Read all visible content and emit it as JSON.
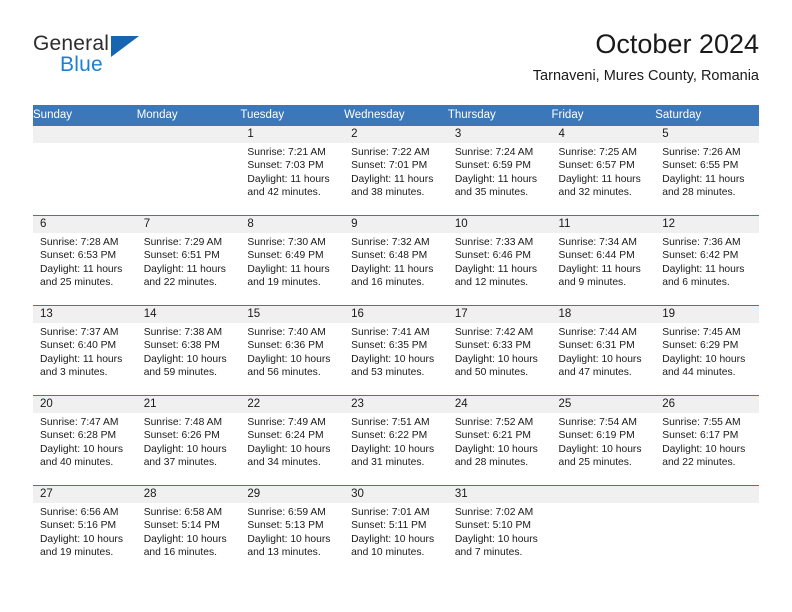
{
  "logo": {
    "word1": "General",
    "word2": "Blue",
    "triangle_color": "#1565b0",
    "blue_text_color": "#1c7fd4"
  },
  "header": {
    "title": "October 2024",
    "subtitle": "Tarnaveni, Mures County, Romania"
  },
  "theme": {
    "header_blue": "#3b77b9",
    "daynum_band": "#f0f0f0",
    "text": "#1a1a1a"
  },
  "weekday_headers": [
    "Sunday",
    "Monday",
    "Tuesday",
    "Wednesday",
    "Thursday",
    "Friday",
    "Saturday"
  ],
  "weeks": [
    [
      {
        "day": "",
        "lines": []
      },
      {
        "day": "",
        "lines": []
      },
      {
        "day": "1",
        "lines": [
          "Sunrise: 7:21 AM",
          "Sunset: 7:03 PM",
          "Daylight: 11 hours",
          "and 42 minutes."
        ]
      },
      {
        "day": "2",
        "lines": [
          "Sunrise: 7:22 AM",
          "Sunset: 7:01 PM",
          "Daylight: 11 hours",
          "and 38 minutes."
        ]
      },
      {
        "day": "3",
        "lines": [
          "Sunrise: 7:24 AM",
          "Sunset: 6:59 PM",
          "Daylight: 11 hours",
          "and 35 minutes."
        ]
      },
      {
        "day": "4",
        "lines": [
          "Sunrise: 7:25 AM",
          "Sunset: 6:57 PM",
          "Daylight: 11 hours",
          "and 32 minutes."
        ]
      },
      {
        "day": "5",
        "lines": [
          "Sunrise: 7:26 AM",
          "Sunset: 6:55 PM",
          "Daylight: 11 hours",
          "and 28 minutes."
        ]
      }
    ],
    [
      {
        "day": "6",
        "lines": [
          "Sunrise: 7:28 AM",
          "Sunset: 6:53 PM",
          "Daylight: 11 hours",
          "and 25 minutes."
        ]
      },
      {
        "day": "7",
        "lines": [
          "Sunrise: 7:29 AM",
          "Sunset: 6:51 PM",
          "Daylight: 11 hours",
          "and 22 minutes."
        ]
      },
      {
        "day": "8",
        "lines": [
          "Sunrise: 7:30 AM",
          "Sunset: 6:49 PM",
          "Daylight: 11 hours",
          "and 19 minutes."
        ]
      },
      {
        "day": "9",
        "lines": [
          "Sunrise: 7:32 AM",
          "Sunset: 6:48 PM",
          "Daylight: 11 hours",
          "and 16 minutes."
        ]
      },
      {
        "day": "10",
        "lines": [
          "Sunrise: 7:33 AM",
          "Sunset: 6:46 PM",
          "Daylight: 11 hours",
          "and 12 minutes."
        ]
      },
      {
        "day": "11",
        "lines": [
          "Sunrise: 7:34 AM",
          "Sunset: 6:44 PM",
          "Daylight: 11 hours",
          "and 9 minutes."
        ]
      },
      {
        "day": "12",
        "lines": [
          "Sunrise: 7:36 AM",
          "Sunset: 6:42 PM",
          "Daylight: 11 hours",
          "and 6 minutes."
        ]
      }
    ],
    [
      {
        "day": "13",
        "lines": [
          "Sunrise: 7:37 AM",
          "Sunset: 6:40 PM",
          "Daylight: 11 hours",
          "and 3 minutes."
        ]
      },
      {
        "day": "14",
        "lines": [
          "Sunrise: 7:38 AM",
          "Sunset: 6:38 PM",
          "Daylight: 10 hours",
          "and 59 minutes."
        ]
      },
      {
        "day": "15",
        "lines": [
          "Sunrise: 7:40 AM",
          "Sunset: 6:36 PM",
          "Daylight: 10 hours",
          "and 56 minutes."
        ]
      },
      {
        "day": "16",
        "lines": [
          "Sunrise: 7:41 AM",
          "Sunset: 6:35 PM",
          "Daylight: 10 hours",
          "and 53 minutes."
        ]
      },
      {
        "day": "17",
        "lines": [
          "Sunrise: 7:42 AM",
          "Sunset: 6:33 PM",
          "Daylight: 10 hours",
          "and 50 minutes."
        ]
      },
      {
        "day": "18",
        "lines": [
          "Sunrise: 7:44 AM",
          "Sunset: 6:31 PM",
          "Daylight: 10 hours",
          "and 47 minutes."
        ]
      },
      {
        "day": "19",
        "lines": [
          "Sunrise: 7:45 AM",
          "Sunset: 6:29 PM",
          "Daylight: 10 hours",
          "and 44 minutes."
        ]
      }
    ],
    [
      {
        "day": "20",
        "lines": [
          "Sunrise: 7:47 AM",
          "Sunset: 6:28 PM",
          "Daylight: 10 hours",
          "and 40 minutes."
        ]
      },
      {
        "day": "21",
        "lines": [
          "Sunrise: 7:48 AM",
          "Sunset: 6:26 PM",
          "Daylight: 10 hours",
          "and 37 minutes."
        ]
      },
      {
        "day": "22",
        "lines": [
          "Sunrise: 7:49 AM",
          "Sunset: 6:24 PM",
          "Daylight: 10 hours",
          "and 34 minutes."
        ]
      },
      {
        "day": "23",
        "lines": [
          "Sunrise: 7:51 AM",
          "Sunset: 6:22 PM",
          "Daylight: 10 hours",
          "and 31 minutes."
        ]
      },
      {
        "day": "24",
        "lines": [
          "Sunrise: 7:52 AM",
          "Sunset: 6:21 PM",
          "Daylight: 10 hours",
          "and 28 minutes."
        ]
      },
      {
        "day": "25",
        "lines": [
          "Sunrise: 7:54 AM",
          "Sunset: 6:19 PM",
          "Daylight: 10 hours",
          "and 25 minutes."
        ]
      },
      {
        "day": "26",
        "lines": [
          "Sunrise: 7:55 AM",
          "Sunset: 6:17 PM",
          "Daylight: 10 hours",
          "and 22 minutes."
        ]
      }
    ],
    [
      {
        "day": "27",
        "lines": [
          "Sunrise: 6:56 AM",
          "Sunset: 5:16 PM",
          "Daylight: 10 hours",
          "and 19 minutes."
        ]
      },
      {
        "day": "28",
        "lines": [
          "Sunrise: 6:58 AM",
          "Sunset: 5:14 PM",
          "Daylight: 10 hours",
          "and 16 minutes."
        ]
      },
      {
        "day": "29",
        "lines": [
          "Sunrise: 6:59 AM",
          "Sunset: 5:13 PM",
          "Daylight: 10 hours",
          "and 13 minutes."
        ]
      },
      {
        "day": "30",
        "lines": [
          "Sunrise: 7:01 AM",
          "Sunset: 5:11 PM",
          "Daylight: 10 hours",
          "and 10 minutes."
        ]
      },
      {
        "day": "31",
        "lines": [
          "Sunrise: 7:02 AM",
          "Sunset: 5:10 PM",
          "Daylight: 10 hours",
          "and 7 minutes."
        ]
      },
      {
        "day": "",
        "lines": []
      },
      {
        "day": "",
        "lines": []
      }
    ]
  ]
}
